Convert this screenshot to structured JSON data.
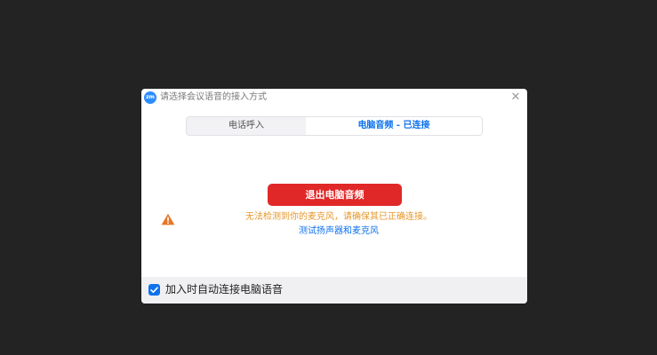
{
  "dialog": {
    "app_icon_text": "zm",
    "title": "请选择会议语音的接入方式",
    "close_symbol": "✕"
  },
  "tabs": [
    {
      "label": "电话呼入",
      "selected": false
    },
    {
      "label": "电脑音频 - 已连接",
      "selected": true
    }
  ],
  "main": {
    "exit_button_label": "退出电脑音频",
    "warning_icon": "warning-triangle-icon",
    "warning_text": "无法检测到你的麦克风，请确保其已正确连接。",
    "test_link_text": "测试扬声器和麦克风"
  },
  "footer": {
    "auto_connect_checked": true,
    "auto_connect_label": "加入时自动连接电脑语音"
  },
  "colors": {
    "accent_blue": "#0e72ed",
    "danger_red": "#e02828",
    "warning_orange": "#e6972a",
    "background": "#232323"
  }
}
